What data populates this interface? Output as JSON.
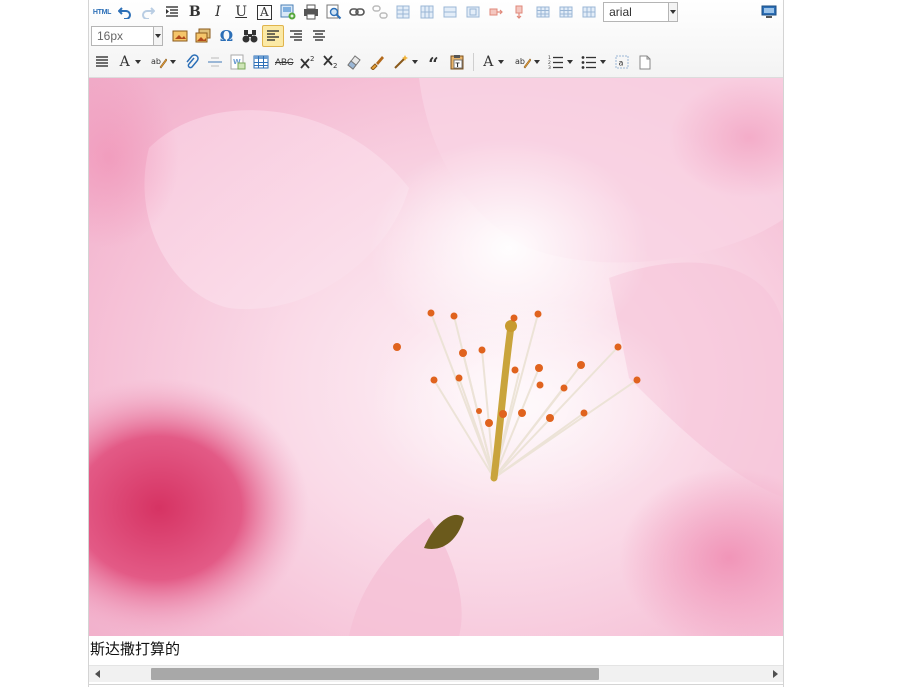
{
  "toolbar": {
    "html_label": "HTML",
    "bold_label": "B",
    "italic_label": "I",
    "underline_label": "U",
    "fontcolor_label": "A",
    "font_family_value": "arial",
    "font_size_value": "16px",
    "strike_label": "ABC"
  },
  "content": {
    "caption": "斯达撒打算的"
  },
  "colors": {
    "accent_blue": "#2c6fb7",
    "active_bg": "#fbe9a5",
    "scroll_thumb": "#a8a8a8"
  }
}
